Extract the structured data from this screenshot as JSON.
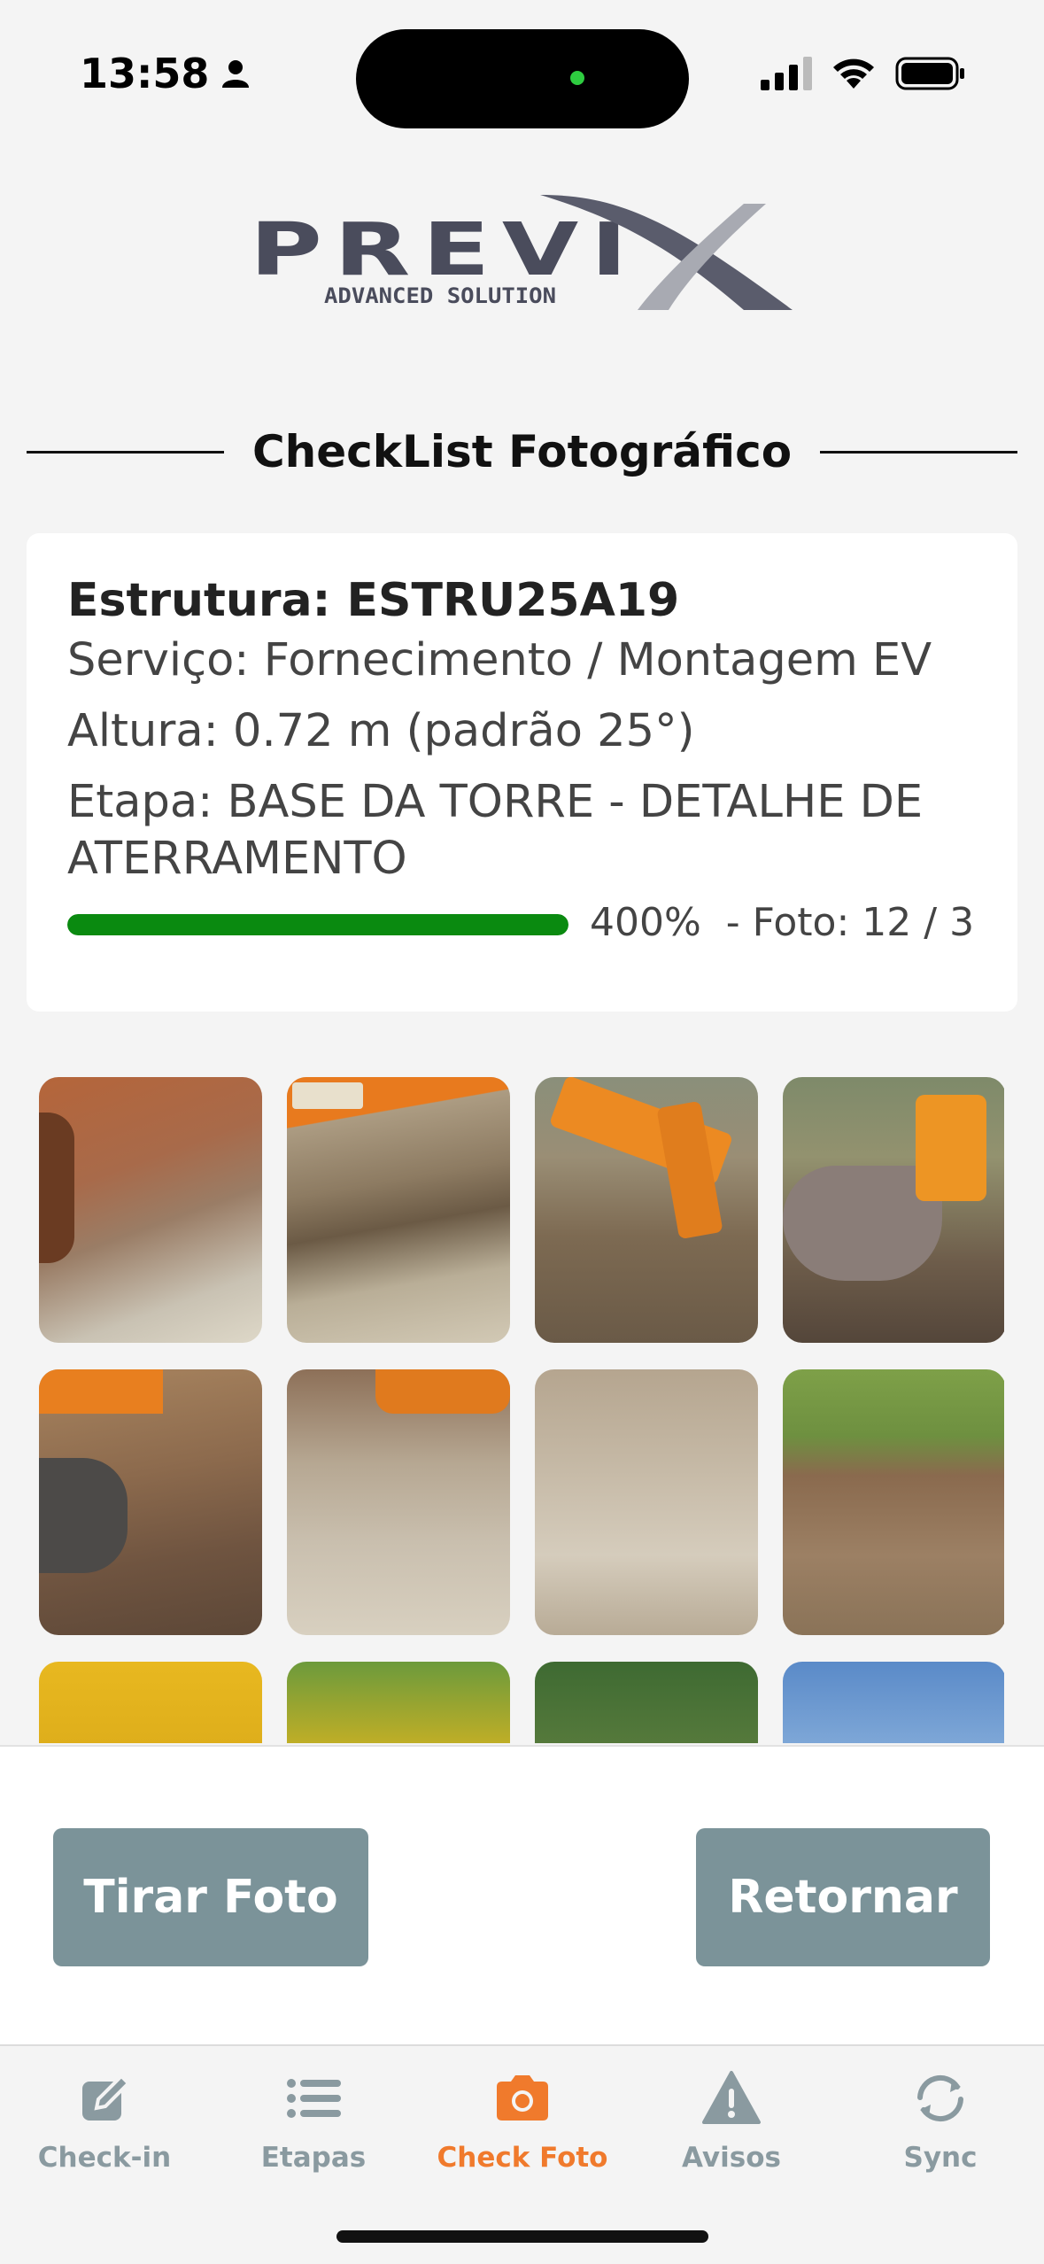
{
  "status_bar": {
    "time": "13:58",
    "icons": [
      "person-icon",
      "cellular-signal-icon",
      "wifi-icon",
      "battery-icon"
    ]
  },
  "logo": {
    "brand": "PREVI",
    "tagline": "ADVANCED SOLUTION"
  },
  "page": {
    "title": "CheckList Fotográfico"
  },
  "info": {
    "estrutura": "Estrutura: ESTRU25A19",
    "servico": "Serviço: Fornecimento / Montagem EV",
    "altura": "Altura: 0.72 m  (padrão 25°)",
    "etapa": "Etapa: BASE DA TORRE - DETALHE DE ATERRAMENTO",
    "progress_percent": "400%",
    "progress_fraction": 1.0,
    "foto_count": "- Foto: 12 / 3"
  },
  "photos": [
    {
      "alt": "Excavated soil with rocks"
    },
    {
      "alt": "JCB backhoe arm over trench"
    },
    {
      "alt": "JCB backhoe arm digging"
    },
    {
      "alt": "Backhoe bucket in grass"
    },
    {
      "alt": "Backhoe bucket in soil"
    },
    {
      "alt": "Rock pile with excavator"
    },
    {
      "alt": "Rocky soil close-up"
    },
    {
      "alt": "Cleared ground with grass"
    },
    {
      "alt": "Yellow JCB machine"
    },
    {
      "alt": "Yellow JCB bucket"
    },
    {
      "alt": "Field with vegetation"
    },
    {
      "alt": "Landscape with sky"
    }
  ],
  "actions": {
    "take_photo": "Tirar Foto",
    "back": "Retornar"
  },
  "tabs": [
    {
      "label": "Check-in",
      "icon": "edit-icon",
      "active": false
    },
    {
      "label": "Etapas",
      "icon": "list-icon",
      "active": false
    },
    {
      "label": "Check Foto",
      "icon": "camera-icon",
      "active": true
    },
    {
      "label": "Avisos",
      "icon": "warning-icon",
      "active": false
    },
    {
      "label": "Sync",
      "icon": "sync-icon",
      "active": false
    }
  ],
  "colors": {
    "accent": "#f07a2c",
    "progress": "#0a8a10",
    "button": "#7b9399",
    "tab_inactive": "#8a9aa0"
  }
}
